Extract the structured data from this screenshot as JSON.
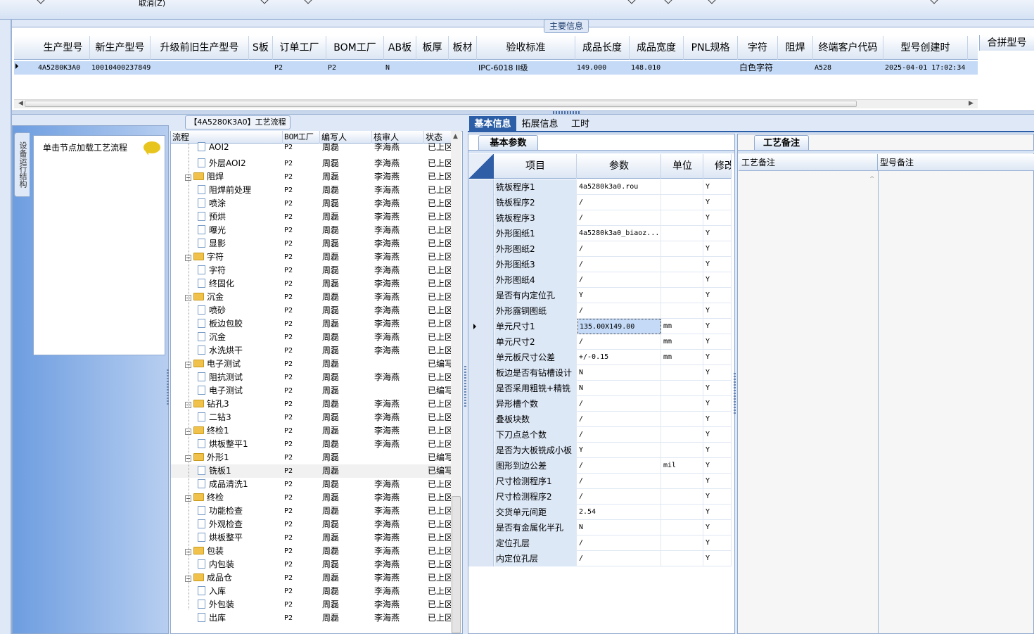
{
  "top": {
    "cancel_label": "取消(Z)"
  },
  "main_info": {
    "title": "主要信息",
    "columns": [
      "生产型号",
      "新生产型号",
      "升级前旧生产型号",
      "S板",
      "订单工厂",
      "BOM工厂",
      "AB板",
      "板厚",
      "板材",
      "验收标准",
      "成品长度",
      "成品宽度",
      "PNL规格",
      "字符",
      "阻焊",
      "终端客户代码",
      "型号创建时"
    ],
    "row": [
      "4A5280K3A0",
      "10010400237849",
      "",
      "",
      "P2",
      "P2",
      "N",
      "",
      "",
      "IPC-6018 II级",
      "149.000",
      "148.010",
      "",
      "白色字符",
      "",
      "A528",
      "2025-04-01 17:02:34"
    ],
    "combined_header": "合拼型号"
  },
  "left_panel": {
    "vertical_tab": "设备运行结构",
    "load_text": "单击节点加载工艺流程"
  },
  "process_tree": {
    "title": "【4A5280K3A0】工艺流程",
    "headers": [
      "流程",
      "BOM工厂",
      "编写人",
      "核审人",
      "状态"
    ],
    "rows": [
      {
        "level": 2,
        "name": "AOI2",
        "bom": "P2",
        "writer": "周磊",
        "reviewer": "李海燕",
        "status": "已上区"
      },
      {
        "level": 2,
        "name": "外层AOI2",
        "bom": "P2",
        "writer": "周磊",
        "reviewer": "李海燕",
        "status": "已上区"
      },
      {
        "level": 1,
        "name": "阻焊",
        "bom": "P2",
        "writer": "周磊",
        "reviewer": "李海燕",
        "status": "已上区"
      },
      {
        "level": 2,
        "name": "阻焊前处理",
        "bom": "P2",
        "writer": "周磊",
        "reviewer": "李海燕",
        "status": "已上区"
      },
      {
        "level": 2,
        "name": "喷涂",
        "bom": "P2",
        "writer": "周磊",
        "reviewer": "李海燕",
        "status": "已上区"
      },
      {
        "level": 2,
        "name": "预烘",
        "bom": "P2",
        "writer": "周磊",
        "reviewer": "李海燕",
        "status": "已上区"
      },
      {
        "level": 2,
        "name": "曝光",
        "bom": "P2",
        "writer": "周磊",
        "reviewer": "李海燕",
        "status": "已上区"
      },
      {
        "level": 2,
        "name": "显影",
        "bom": "P2",
        "writer": "周磊",
        "reviewer": "李海燕",
        "status": "已上区"
      },
      {
        "level": 1,
        "name": "字符",
        "bom": "P2",
        "writer": "周磊",
        "reviewer": "李海燕",
        "status": "已上区"
      },
      {
        "level": 2,
        "name": "字符",
        "bom": "P2",
        "writer": "周磊",
        "reviewer": "李海燕",
        "status": "已上区"
      },
      {
        "level": 2,
        "name": "终固化",
        "bom": "P2",
        "writer": "周磊",
        "reviewer": "李海燕",
        "status": "已上区"
      },
      {
        "level": 1,
        "name": "沉金",
        "bom": "P2",
        "writer": "周磊",
        "reviewer": "李海燕",
        "status": "已上区"
      },
      {
        "level": 2,
        "name": "喷砂",
        "bom": "P2",
        "writer": "周磊",
        "reviewer": "李海燕",
        "status": "已上区"
      },
      {
        "level": 2,
        "name": "板边包胶",
        "bom": "P2",
        "writer": "周磊",
        "reviewer": "李海燕",
        "status": "已上区"
      },
      {
        "level": 2,
        "name": "沉金",
        "bom": "P2",
        "writer": "周磊",
        "reviewer": "李海燕",
        "status": "已上区"
      },
      {
        "level": 2,
        "name": "水洗烘干",
        "bom": "P2",
        "writer": "周磊",
        "reviewer": "李海燕",
        "status": "已上区"
      },
      {
        "level": 1,
        "name": "电子测试",
        "bom": "P2",
        "writer": "周磊",
        "reviewer": "",
        "status": "已编写"
      },
      {
        "level": 2,
        "name": "阻抗测试",
        "bom": "P2",
        "writer": "周磊",
        "reviewer": "李海燕",
        "status": "已上区"
      },
      {
        "level": 2,
        "name": "电子测试",
        "bom": "P2",
        "writer": "周磊",
        "reviewer": "",
        "status": "已编写"
      },
      {
        "level": 1,
        "name": "钻孔3",
        "bom": "P2",
        "writer": "周磊",
        "reviewer": "李海燕",
        "status": "已上区"
      },
      {
        "level": 2,
        "name": "二钻3",
        "bom": "P2",
        "writer": "周磊",
        "reviewer": "李海燕",
        "status": "已上区"
      },
      {
        "level": 1,
        "name": "终检1",
        "bom": "P2",
        "writer": "周磊",
        "reviewer": "李海燕",
        "status": "已上区"
      },
      {
        "level": 2,
        "name": "烘板整平1",
        "bom": "P2",
        "writer": "周磊",
        "reviewer": "李海燕",
        "status": "已上区"
      },
      {
        "level": 1,
        "name": "外形1",
        "bom": "P2",
        "writer": "周磊",
        "reviewer": "",
        "status": "已编写"
      },
      {
        "level": 2,
        "name": "铣板1",
        "bom": "P2",
        "writer": "周磊",
        "reviewer": "",
        "status": "已编写"
      },
      {
        "level": 2,
        "name": "成品清洗1",
        "bom": "P2",
        "writer": "周磊",
        "reviewer": "李海燕",
        "status": "已上区"
      },
      {
        "level": 1,
        "name": "终检",
        "bom": "P2",
        "writer": "周磊",
        "reviewer": "李海燕",
        "status": "已上区"
      },
      {
        "level": 2,
        "name": "功能检查",
        "bom": "P2",
        "writer": "周磊",
        "reviewer": "李海燕",
        "status": "已上区"
      },
      {
        "level": 2,
        "name": "外观检查",
        "bom": "P2",
        "writer": "周磊",
        "reviewer": "李海燕",
        "status": "已上区"
      },
      {
        "level": 2,
        "name": "烘板整平",
        "bom": "P2",
        "writer": "周磊",
        "reviewer": "李海燕",
        "status": "已上区"
      },
      {
        "level": 1,
        "name": "包装",
        "bom": "P2",
        "writer": "周磊",
        "reviewer": "李海燕",
        "status": "已上区"
      },
      {
        "level": 2,
        "name": "内包装",
        "bom": "P2",
        "writer": "周磊",
        "reviewer": "李海燕",
        "status": "已上区"
      },
      {
        "level": 1,
        "name": "成品仓",
        "bom": "P2",
        "writer": "周磊",
        "reviewer": "李海燕",
        "status": "已上区"
      },
      {
        "level": 2,
        "name": "入库",
        "bom": "P2",
        "writer": "周磊",
        "reviewer": "李海燕",
        "status": "已上区"
      },
      {
        "level": 2,
        "name": "外包装",
        "bom": "P2",
        "writer": "周磊",
        "reviewer": "李海燕",
        "status": "已上区"
      },
      {
        "level": 2,
        "name": "出库",
        "bom": "P2",
        "writer": "周磊",
        "reviewer": "李海燕",
        "status": "已上区"
      }
    ],
    "selected_index": 24
  },
  "right_tabs": [
    "基本信息",
    "拓展信息",
    "工时"
  ],
  "params": {
    "tab": "基本参数",
    "headers": [
      "项目",
      "参数",
      "单位",
      "修改"
    ],
    "rows": [
      [
        "铣板程序1",
        "4a5280k3a0.rou",
        "",
        "Y"
      ],
      [
        "铣板程序2",
        "/",
        "",
        "Y"
      ],
      [
        "铣板程序3",
        "/",
        "",
        "Y"
      ],
      [
        "外形图纸1",
        "4a5280k3a0_biaoz...",
        "",
        "Y"
      ],
      [
        "外形图纸2",
        "/",
        "",
        "Y"
      ],
      [
        "外形图纸3",
        "/",
        "",
        "Y"
      ],
      [
        "外形图纸4",
        "/",
        "",
        "Y"
      ],
      [
        "是否有内定位孔",
        "Y",
        "",
        "Y"
      ],
      [
        "外形露铜图纸",
        "/",
        "",
        "Y"
      ],
      [
        "单元尺寸1",
        "135.00X149.00",
        "mm",
        "Y"
      ],
      [
        "单元尺寸2",
        "/",
        "mm",
        "Y"
      ],
      [
        "单元板尺寸公差",
        "+/-0.15",
        "mm",
        "Y"
      ],
      [
        "板边是否有钻槽设计",
        "N",
        "",
        "Y"
      ],
      [
        "是否采用粗铣+精铣",
        "N",
        "",
        "Y"
      ],
      [
        "异形槽个数",
        "/",
        "",
        "Y"
      ],
      [
        "叠板块数",
        "/",
        "",
        "Y"
      ],
      [
        "下刀点总个数",
        "/",
        "",
        "Y"
      ],
      [
        "是否为大板铣成小板",
        "Y",
        "",
        "Y"
      ],
      [
        "图形到边公差",
        "/",
        "mil",
        "Y"
      ],
      [
        "尺寸检测程序1",
        "/",
        "",
        "Y"
      ],
      [
        "尺寸检测程序2",
        "/",
        "",
        "Y"
      ],
      [
        "交货单元间距",
        "2.54",
        "",
        "Y"
      ],
      [
        "是否有金属化半孔",
        "N",
        "",
        "Y"
      ],
      [
        "定位孔层",
        "/",
        "",
        "Y"
      ],
      [
        "内定位孔层",
        "/",
        "",
        "Y"
      ]
    ],
    "selected_index": 9
  },
  "notes": {
    "tab": "工艺备注",
    "col1": "工艺备注",
    "col2": "型号备注"
  }
}
